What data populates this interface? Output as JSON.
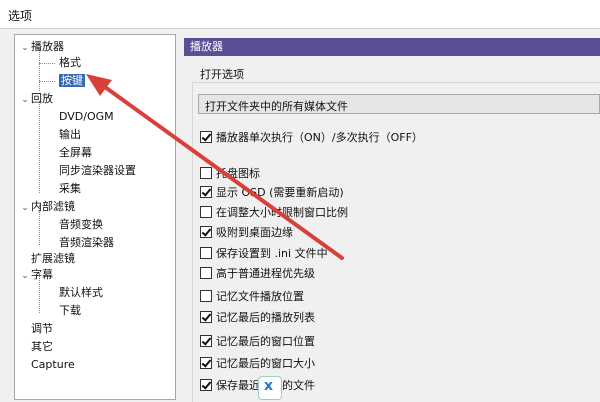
{
  "window": {
    "title": "选项"
  },
  "tree": [
    {
      "label": "播放器",
      "expanded": true,
      "selected": false
    },
    {
      "label": "格式"
    },
    {
      "label": "按键",
      "active": true
    },
    {
      "label": "回放",
      "expanded": true
    },
    {
      "label": "DVD/OGM"
    },
    {
      "label": "输出"
    },
    {
      "label": "全屏幕"
    },
    {
      "label": "同步渲染器设置"
    },
    {
      "label": "采集"
    },
    {
      "label": "内部滤镜",
      "expanded": true
    },
    {
      "label": "音频变换"
    },
    {
      "label": "音频渲染器"
    },
    {
      "label": "扩展滤镜"
    },
    {
      "label": "字幕",
      "expanded": true
    },
    {
      "label": "默认样式"
    },
    {
      "label": "下载"
    },
    {
      "label": "调节"
    },
    {
      "label": "其它"
    },
    {
      "label": "Capture"
    }
  ],
  "panel": {
    "header": "播放器",
    "group_label": "打开选项",
    "dropdown_value": "打开文件夹中的所有媒体文件",
    "checkboxes": [
      {
        "label": "播放器单次执行（ON）/多次执行（OFF）",
        "checked": true
      },
      {
        "label": "托盘图标",
        "checked": false
      },
      {
        "label": "显示 OSD (需要重新启动)",
        "checked": true
      },
      {
        "label": "在调整大小时限制窗口比例",
        "checked": false
      },
      {
        "label": "吸附到桌面边缘",
        "checked": true
      },
      {
        "label": "保存设置到 .ini 文件中",
        "checked": false
      },
      {
        "label": "高于普通进程优先级",
        "checked": false
      },
      {
        "label": "记忆文件播放位置",
        "checked": false
      },
      {
        "label": "记忆最后的播放列表",
        "checked": true
      },
      {
        "label": "记忆最后的窗口位置",
        "checked": true
      },
      {
        "label": "记忆最后的窗口大小",
        "checked": true
      },
      {
        "label": "保存最近打开的文件",
        "checked": true
      }
    ]
  },
  "colors": {
    "panel_header_bg": "#5b4f96",
    "arrow": "#d9403a",
    "selected_tree_bg": "#3469b7"
  }
}
